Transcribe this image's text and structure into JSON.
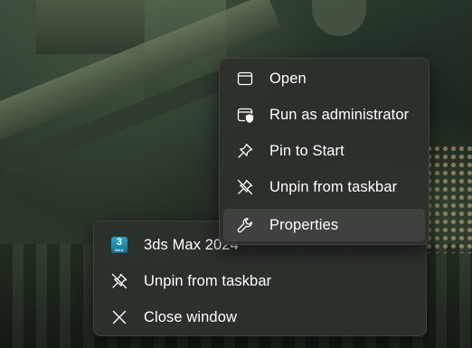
{
  "context_menu": {
    "items": [
      {
        "label": "Open",
        "icon": "window-icon"
      },
      {
        "label": "Run as administrator",
        "icon": "shield-window-icon"
      },
      {
        "label": "Pin to Start",
        "icon": "pin-icon"
      },
      {
        "label": "Unpin from taskbar",
        "icon": "unpin-icon"
      },
      {
        "label": "Properties",
        "icon": "wrench-icon",
        "highlighted": true
      }
    ]
  },
  "jump_list": {
    "app": {
      "label": "3ds Max 2024",
      "tile_number": "3",
      "tile_caption": "MAX",
      "tile_color": "#1f8fb8"
    },
    "items": [
      {
        "label": "Unpin from taskbar",
        "icon": "unpin-icon"
      },
      {
        "label": "Close window",
        "icon": "close-icon"
      }
    ]
  },
  "colors": {
    "menu_background": "#2c312b",
    "menu_text": "#ffffff",
    "hover_highlight": "#3f443e"
  }
}
